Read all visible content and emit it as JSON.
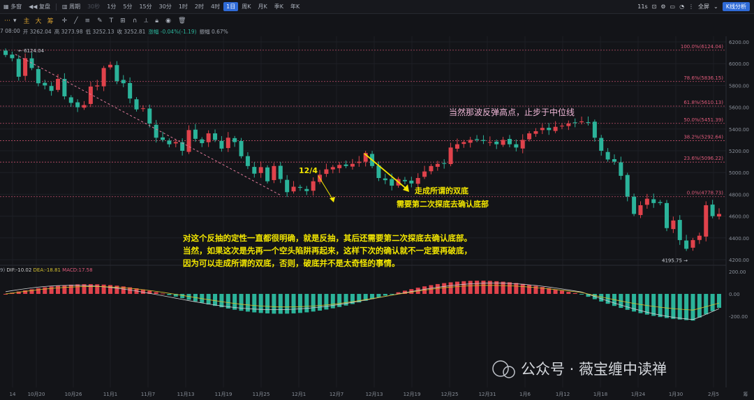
{
  "toolbar": {
    "items": [
      {
        "name": "multi-window",
        "label": "多窗"
      },
      {
        "name": "restore",
        "label": "复盘"
      },
      {
        "name": "period",
        "label": "周期"
      }
    ],
    "periods": [
      "30秒",
      "1分",
      "5分",
      "15分",
      "30分",
      "1时",
      "2时",
      "4时",
      "1日",
      "周K",
      "月K",
      "季K",
      "年K"
    ],
    "active_period": "1日",
    "interval": "11s",
    "fullscreen": "全屏",
    "kline_btn": "K线分析"
  },
  "indicators": [
    "主",
    "大",
    "筹"
  ],
  "ohlc": {
    "date": "7 08:00",
    "open": "开 3262.04",
    "high": "高 3273.98",
    "low": "低 3252.13",
    "close": "收 3252.81",
    "change": "涨幅 -0.04%(-1.19)",
    "amplitude": "振幅 0.67%"
  },
  "price_axis": [
    "6200.00",
    "6000.00",
    "5800.00",
    "5600.00",
    "5400.00",
    "5200.00",
    "5000.00",
    "4800.00",
    "4600.00",
    "4400.00",
    "4200.00"
  ],
  "macd_axis": [
    "200.00",
    "0.00",
    "-200.00"
  ],
  "macd_labels": {
    "prefix": "9)",
    "dif": "DIF:-10.02",
    "dea": "DEA:-18.81",
    "macd": "MACD:17.58"
  },
  "date_axis": [
    "14",
    "10月20",
    "10月26",
    "11月1",
    "11月7",
    "11月13",
    "11月19",
    "11月25",
    "12月1",
    "12月7",
    "12月13",
    "12月19",
    "12月25",
    "12月31",
    "1月6",
    "1月12",
    "1月18",
    "1月24",
    "1月30",
    "2月5",
    "筹"
  ],
  "fib_levels": [
    {
      "label": "100.0%(6124.04)",
      "price": 6124.04
    },
    {
      "label": "78.6%(5836.15)",
      "price": 5836.15
    },
    {
      "label": "61.8%(5610.13)",
      "price": 5610.13
    },
    {
      "label": "50.0%(5451.39)",
      "price": 5451.39
    },
    {
      "label": "38.2%(5292.64)",
      "price": 5292.64
    },
    {
      "label": "23.6%(5096.22)",
      "price": 5096.22
    },
    {
      "label": "0.0%(4778.73)",
      "price": 4778.73
    }
  ],
  "price_marks": {
    "high": "6124.04",
    "low": "4195.75"
  },
  "annotations": {
    "date_label": "12/4",
    "double_bottom": "走成所谓的双底",
    "second_test": "需要第二次探底去确认底部",
    "rebound_high": "当然那波反弹高点，止步于中位线",
    "para1": "对这个反抽的定性一直都很明确，就是反抽，其后还需要第二次探底去确认底部。",
    "para2": "当然，如果这次是先再一个空头陷阱再起来，这样下次的确认就不一定要再破底，",
    "para3": "因为可以走成所谓的双底，否则，破底并不是太奇怪的事情。"
  },
  "watermark": "公众号 · 薇宝缠中读禅",
  "colors": {
    "up": "#e0424b",
    "down": "#2bb39a",
    "fib": "#e05a7a",
    "annotation": "#f2e600",
    "rebound_text": "#f1b8d8",
    "dif": "#d0d0d0",
    "dea": "#d4c030"
  }
}
